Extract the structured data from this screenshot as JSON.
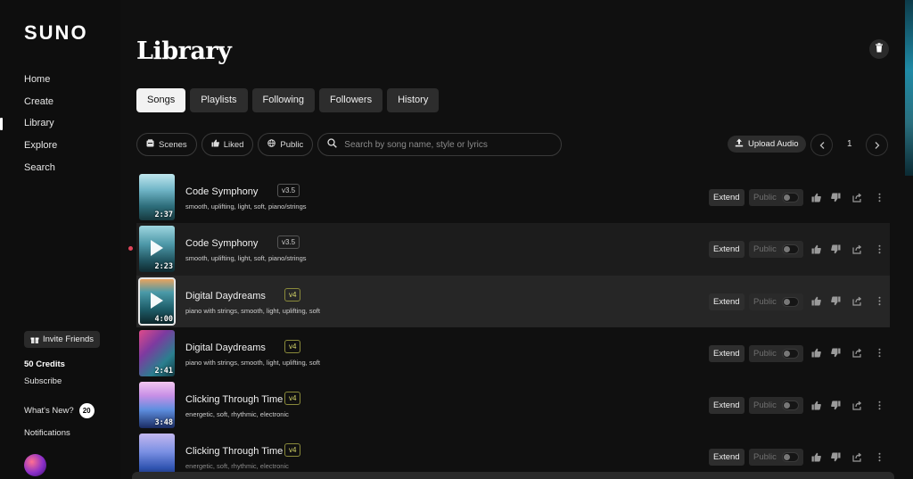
{
  "brand": {
    "logo": "SUNO"
  },
  "sidebar": {
    "nav": [
      "Home",
      "Create",
      "Library",
      "Explore",
      "Search"
    ],
    "active": "Library",
    "invite_label": "Invite Friends",
    "credits": "50 Credits",
    "subscribe": "Subscribe",
    "whats_new": "What's New?",
    "whats_new_count": "20",
    "notifications": "Notifications"
  },
  "header": {
    "title": "Library"
  },
  "tabs": [
    {
      "label": "Songs",
      "active": true
    },
    {
      "label": "Playlists",
      "active": false
    },
    {
      "label": "Following",
      "active": false
    },
    {
      "label": "Followers",
      "active": false
    },
    {
      "label": "History",
      "active": false
    }
  ],
  "filters": {
    "scenes": "Scenes",
    "liked": "Liked",
    "public": "Public"
  },
  "search": {
    "placeholder": "Search by song name, style or lyrics",
    "value": ""
  },
  "upload": {
    "label": "Upload Audio"
  },
  "pagination": {
    "page": "1"
  },
  "row_actions": {
    "extend": "Extend",
    "public": "Public"
  },
  "songs": [
    {
      "title": "Code Symphony",
      "version": "v3.5",
      "tags": "smooth, uplifting, light, soft, piano/strings",
      "duration": "2:37",
      "art": "linear-gradient(180deg,#bfe7ee 0%,#6fb4c6 35%,#2d6d7a 70%,#17393f 100%)"
    },
    {
      "title": "Code Symphony",
      "version": "v3.5",
      "tags": "smooth, uplifting, light, soft, piano/strings",
      "duration": "2:23",
      "art": "linear-gradient(180deg,#9fd6e0 0%,#4d98a8 40%,#215561 75%,#0f2a30 100%)"
    },
    {
      "title": "Digital Daydreams",
      "version": "v4",
      "tags": "piano with strings, smooth, light, uplifting, soft",
      "duration": "4:00",
      "art": "linear-gradient(180deg,#f2a45a 0%,#4a9aa8 30%,#1f5f6b 65%,#0c2428 100%)"
    },
    {
      "title": "Digital Daydreams",
      "version": "v4",
      "tags": "piano with strings, smooth, light, uplifting, soft",
      "duration": "2:41",
      "art": "linear-gradient(135deg,#e04a8a 0%,#7d3aa0 35%,#2a7f8f 70%,#123c44 100%)"
    },
    {
      "title": "Clicking Through Time",
      "version": "v4",
      "tags": "energetic, soft, rhythmic, electronic",
      "duration": "3:48",
      "art": "linear-gradient(180deg,#f3c7f0 0%,#c78fe6 30%,#5e8fe0 60%,#1a2c63 100%)"
    },
    {
      "title": "Clicking Through Time",
      "version": "v4",
      "tags": "energetic, soft, rhythmic, electronic",
      "duration": "",
      "art": "linear-gradient(180deg,#c3b8f0 0%,#7a8fe3 40%,#2f53b0 75%,#101d4a 100%)"
    }
  ]
}
